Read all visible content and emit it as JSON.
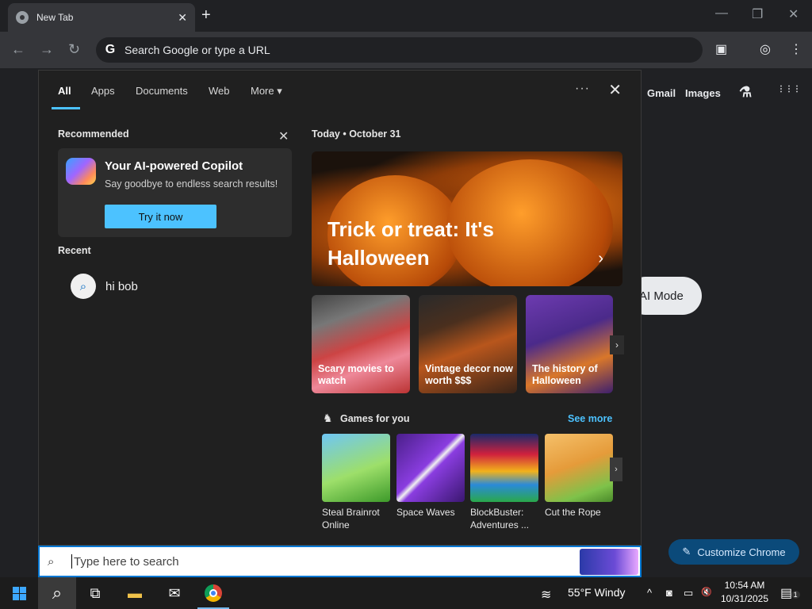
{
  "browser": {
    "tab_title": "New Tab",
    "tab_close": "✕",
    "new_tab": "+",
    "window_controls": {
      "minimize": "—",
      "maximize": "❐",
      "close": "✕"
    },
    "nav": {
      "back": "←",
      "forward": "→",
      "reload": "↻"
    },
    "omnibox_icon": "G",
    "omnibox_placeholder": "Search Google or type a URL",
    "toolbar_icons": {
      "cast": "▣",
      "profile": "◎",
      "menu": "⋮"
    }
  },
  "newtab_page": {
    "gmail": "Gmail",
    "images": "Images",
    "labs_icon": "⚗",
    "apps_icon": "⋮⋮⋮",
    "ai_mode": "AI Mode",
    "customize_chrome": "Customize Chrome",
    "customize_icon": "✎"
  },
  "flyout": {
    "tabs": [
      {
        "label": "All",
        "active": true
      },
      {
        "label": "Apps"
      },
      {
        "label": "Documents"
      },
      {
        "label": "Web"
      },
      {
        "label": "More ▾"
      }
    ],
    "more_options": "···",
    "close": "✕",
    "recommended": {
      "label": "Recommended",
      "close": "✕",
      "title": "Your AI-powered Copilot",
      "subtitle": "Say goodbye to endless search results!",
      "button": "Try it now"
    },
    "recent": {
      "label": "Recent",
      "items": [
        {
          "icon": "⌕",
          "text": "hi bob"
        }
      ]
    },
    "today": {
      "label": "Today • October 31",
      "hero_title": "Trick or treat: It's Halloween",
      "hero_arrow": "›",
      "cards": [
        {
          "text": "Scary movies to watch"
        },
        {
          "text": "Vintage decor now worth $$$"
        },
        {
          "text": "The history of Halloween"
        }
      ],
      "cards_arrow": "›"
    },
    "games": {
      "icon": "♞",
      "label": "Games for you",
      "see_more": "See more",
      "arrow": "›",
      "items": [
        {
          "name": "Steal Brainrot Online"
        },
        {
          "name": "Space Waves"
        },
        {
          "name": "BlockBuster: Adventures ..."
        },
        {
          "name": "Cut the Rope"
        }
      ]
    }
  },
  "search": {
    "icon": "⌕",
    "placeholder": "Type here to search"
  },
  "taskbar": {
    "search_icon": "⌕",
    "taskview_icon": "⧉",
    "explorer_icon": "▬",
    "mail_icon": "✉",
    "weather": "55°F  Windy",
    "weather_icon": "≋",
    "tray": {
      "chevron": "^",
      "meet": "◙",
      "network": "▭",
      "volume": "🔇"
    },
    "time": "10:54 AM",
    "date": "10/31/2025",
    "notifications": "1",
    "notifications_icon": "▤"
  },
  "colors": {
    "accent": "#4cc2ff",
    "flyout_bg": "#202020",
    "taskbar_bg": "#1c1c1c",
    "search_border": "#0078d4"
  }
}
